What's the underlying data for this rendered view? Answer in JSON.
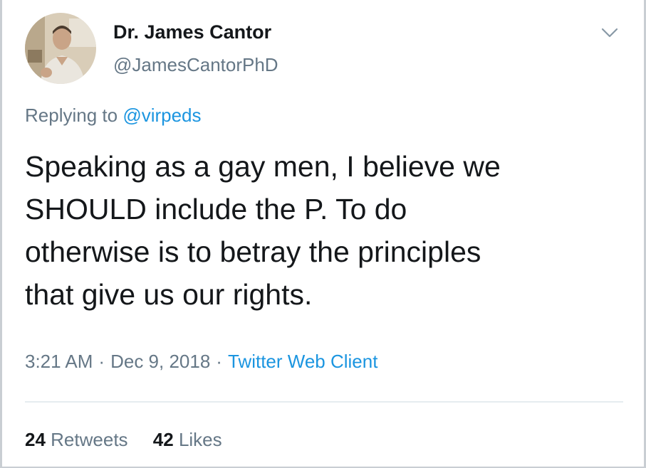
{
  "tweet": {
    "author": {
      "name": "Dr. James Cantor",
      "handle": "@JamesCantorPhD"
    },
    "reply": {
      "prefix": "Replying to ",
      "mention": "@virpeds"
    },
    "text_lines": [
      "Speaking as a gay men, I believe we",
      "SHOULD include the P.  To do",
      "otherwise is to betray the principles",
      "that give us our rights."
    ],
    "meta": {
      "time": "3:21 AM",
      "separator": "·",
      "date": "Dec 9, 2018",
      "source": "Twitter Web Client"
    },
    "stats": {
      "retweets_count": "24",
      "retweets_label": "Retweets",
      "likes_count": "42",
      "likes_label": "Likes"
    },
    "icons": {
      "menu": "chevron-down-icon",
      "avatar": "avatar-photo"
    }
  },
  "colors": {
    "text_primary": "#14171a",
    "text_secondary": "#657786",
    "link": "#1b95e0",
    "divider": "#e6ecf0"
  }
}
